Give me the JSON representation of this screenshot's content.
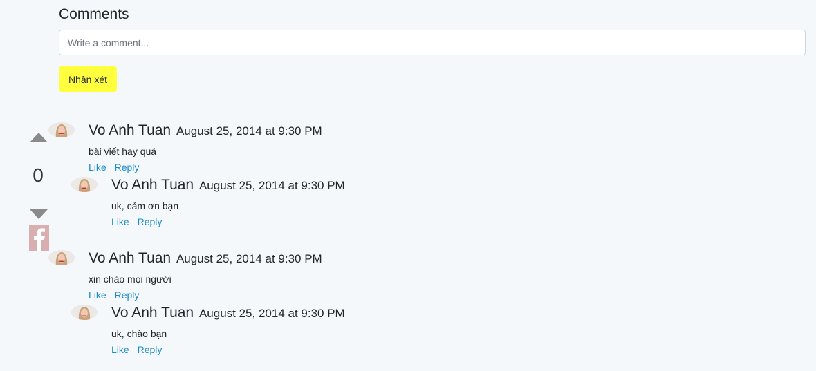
{
  "comments_section": {
    "title": "Comments",
    "input_placeholder": "Write a comment...",
    "submit_label": "Nhận xét"
  },
  "vote": {
    "count": "0"
  },
  "colors": {
    "submit_button": "#ffff3d",
    "link": "#1a8cc8",
    "arrow": "#8a8a8a",
    "facebook_icon_bg": "#d8aeb0",
    "page_bg": "#f5f8fb"
  },
  "comments": [
    {
      "author": "Vo Anh Tuan",
      "date": "August 25, 2014 at 9:30 PM",
      "body": "bài viết hay quá",
      "like_label": "Like",
      "reply_label": "Reply",
      "replies": [
        {
          "author": "Vo Anh Tuan",
          "date": "August 25, 2014 at 9:30 PM",
          "body": "uk, cảm ơn bạn",
          "like_label": "Like",
          "reply_label": "Reply"
        }
      ]
    },
    {
      "author": "Vo Anh Tuan",
      "date": "August 25, 2014 at 9:30 PM",
      "body": "xin chào mọi người",
      "like_label": "Like",
      "reply_label": "Reply",
      "replies": [
        {
          "author": "Vo Anh Tuan",
          "date": "August 25, 2014 at 9:30 PM",
          "body": "uk, chào bạn",
          "like_label": "Like",
          "reply_label": "Reply"
        }
      ]
    }
  ]
}
